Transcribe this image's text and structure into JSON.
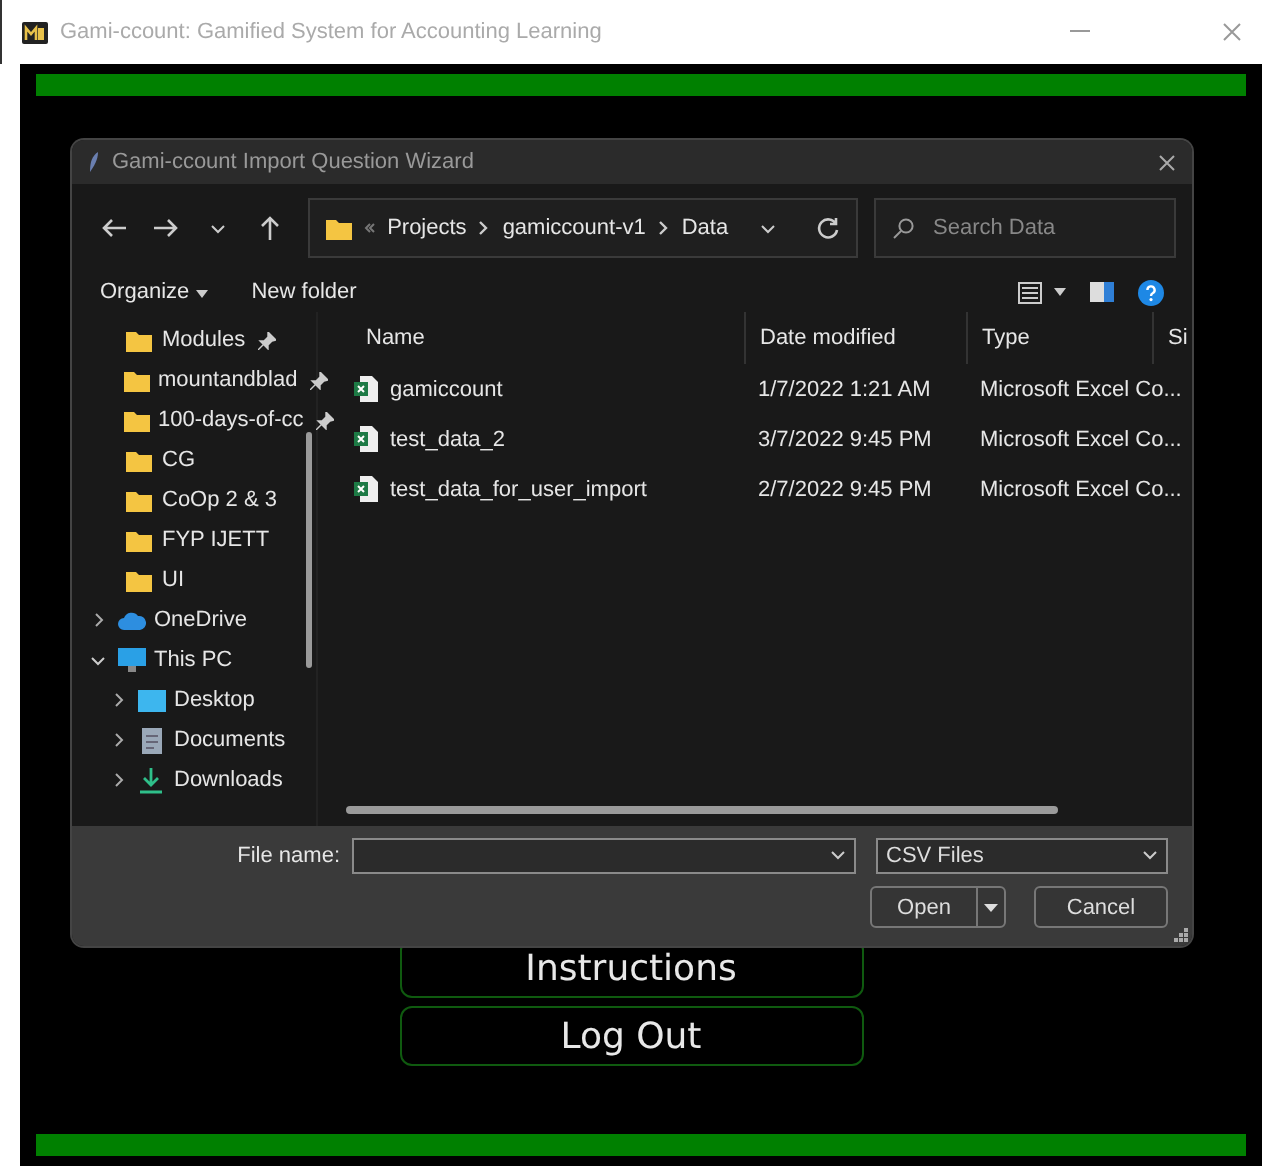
{
  "window": {
    "title": "Gami-ccount: Gamified System for Accounting Learning"
  },
  "menu_buttons": [
    {
      "label": "Instructions"
    },
    {
      "label": "Log Out"
    }
  ],
  "dialog": {
    "title": "Gami-ccount Import Question Wizard",
    "breadcrumb": [
      "Projects",
      "gamiccount-v1",
      "Data"
    ],
    "search": {
      "placeholder": "Search Data"
    },
    "toolbar": [
      "Organize",
      "New folder"
    ],
    "quick_access": [
      {
        "label": "Modules",
        "pinned": true
      },
      {
        "label": "mountandblad",
        "pinned": true
      },
      {
        "label": "100-days-of-cc",
        "pinned": true
      },
      {
        "label": "CG",
        "pinned": false
      },
      {
        "label": "CoOp 2 & 3",
        "pinned": false
      },
      {
        "label": "FYP IJETT",
        "pinned": false
      },
      {
        "label": "UI",
        "pinned": false
      }
    ],
    "tree": [
      {
        "label": "OneDrive",
        "kind": "cloud",
        "expanded": false
      },
      {
        "label": "This PC",
        "kind": "pc",
        "expanded": true,
        "children": [
          {
            "label": "Desktop",
            "kind": "desktop",
            "expanded": false
          },
          {
            "label": "Documents",
            "kind": "documents",
            "expanded": false
          },
          {
            "label": "Downloads",
            "kind": "downloads",
            "expanded": false
          }
        ]
      }
    ],
    "columns": [
      "Name",
      "Date modified",
      "Type",
      "Si"
    ],
    "files": [
      {
        "name": "gamiccount",
        "date_modified": "1/7/2022 1:21 AM",
        "type": "Microsoft Excel Co..."
      },
      {
        "name": "test_data_2",
        "date_modified": "3/7/2022 9:45 PM",
        "type": "Microsoft Excel Co..."
      },
      {
        "name": "test_data_for_user_import",
        "date_modified": "2/7/2022 9:45 PM",
        "type": "Microsoft Excel Co..."
      }
    ],
    "file_name_label": "File name:",
    "file_type": "CSV Files",
    "buttons": [
      "Open",
      "Cancel"
    ]
  }
}
